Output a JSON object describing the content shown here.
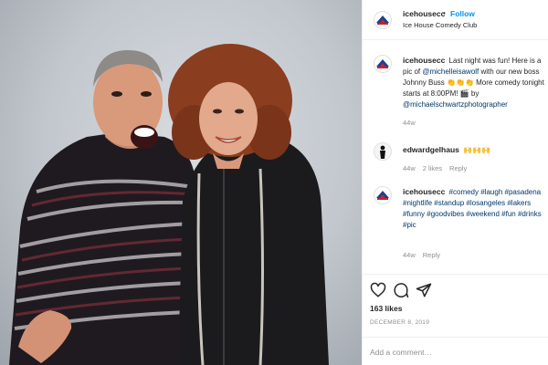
{
  "post": {
    "account": {
      "handle": "icehousecc",
      "dot": "•",
      "follow_label": "Follow",
      "name": "Ice House Comedy Club"
    },
    "caption": {
      "handle": "icehousecc",
      "text_1": "Last night was fun! Here is a pic of ",
      "mention_1": "@michelleisawolf",
      "text_2": " with our new boss Johnny Buss 👏👏👏 More comedy tonight starts at 8:00PM! 🎬 by ",
      "mention_2": "@michaelschwartzphotographer",
      "time": "44w"
    },
    "comments": [
      {
        "handle": "edwardgelhaus",
        "text": "🙌🙌🙌",
        "time": "44w",
        "likes": "2 likes",
        "reply": "Reply"
      },
      {
        "handle": "icehousecc",
        "tags": [
          "#comedy",
          "#laugh",
          "#pasadena",
          "#nightlife",
          "#standup",
          "#losangeles",
          "#lakers",
          "#funny",
          "#goodvibes",
          "#weekend",
          "#fun",
          "#drinks",
          "#pic"
        ],
        "time": "44w",
        "reply": "Reply"
      }
    ],
    "likes_count": "163 likes",
    "date": "DECEMBER 8, 2019",
    "add_comment_placeholder": "Add a comment…"
  },
  "colors": {
    "link": "#00376b",
    "follow": "#0095f6",
    "muted": "#8e8e8e",
    "text": "#262626"
  },
  "icons": [
    "heart-icon",
    "comment-icon",
    "share-icon"
  ]
}
